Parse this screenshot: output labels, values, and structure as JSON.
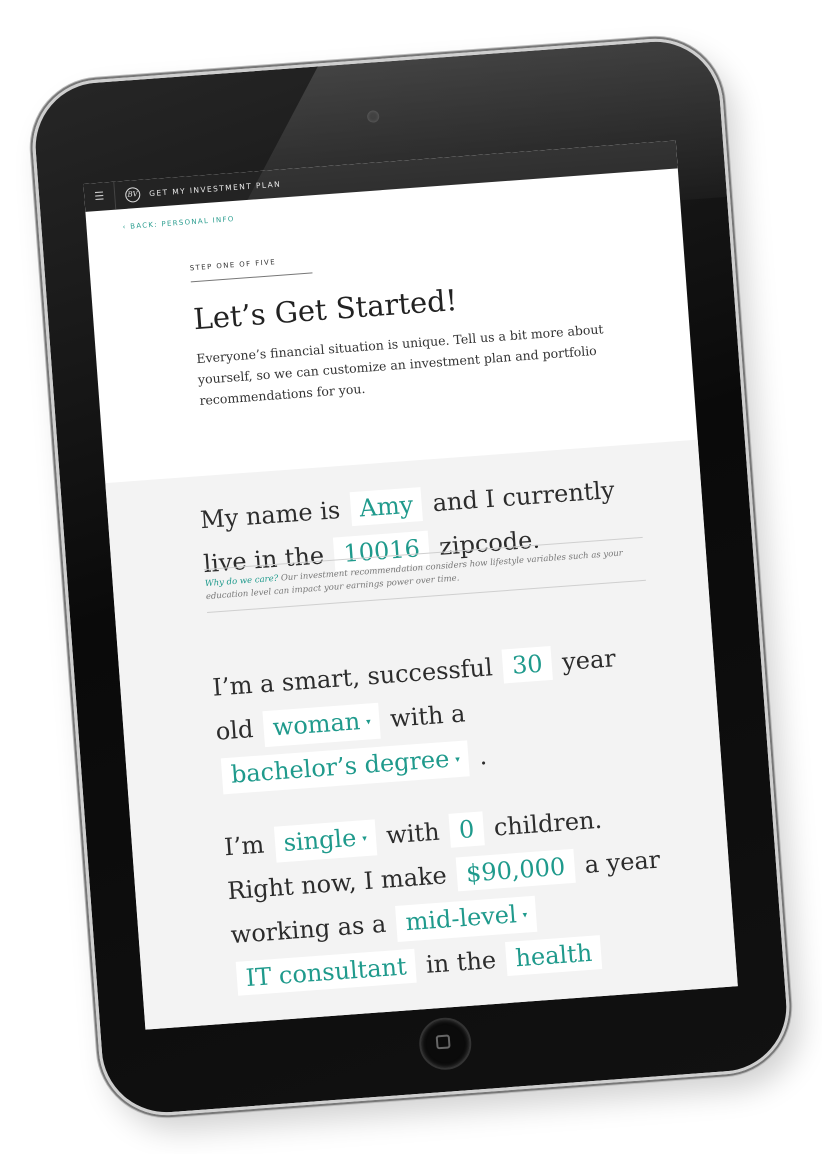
{
  "app": {
    "menu_icon": "☰",
    "logo_text": "BV",
    "title": "GET MY INVESTMENT PLAN"
  },
  "back_link": "‹ BACK: PERSONAL INFO",
  "step": {
    "label": "STEP ONE OF FIVE",
    "title": "Let’s Get Started!",
    "intro": "Everyone’s financial situation is unique. Tell us a bit more about yourself, so we can customize an investment plan and portfolio recommendations for you."
  },
  "form": {
    "s1": {
      "t1": "My name is",
      "name": "Amy",
      "t2": "and I currently live in the",
      "zipcode": "10016",
      "t3": "zipcode."
    },
    "why": {
      "label": "Why do we care?",
      "text": "Our investment recommendation considers how lifestyle variables such as your education level can impact your earnings power over time."
    },
    "s2": {
      "t1": "I’m a smart, successful",
      "age": "30",
      "t2": "year old",
      "gender": "woman",
      "t3": "with a",
      "education": "bachelor’s degree",
      "t4": "."
    },
    "s3": {
      "t1": "I’m",
      "status": "single",
      "t2": "with",
      "children": "0",
      "t3": "children. Right now, I make",
      "income": "$90,000",
      "t4": "a year working as a",
      "level": "mid-level",
      "job": "IT consultant",
      "t5": "in the",
      "industry": "health"
    }
  },
  "colors": {
    "accent": "#1f9a8c",
    "topbar": "#232323",
    "form_bg": "#f3f3f3"
  },
  "icons": {
    "caret": "▾",
    "home": "home-button-icon"
  }
}
